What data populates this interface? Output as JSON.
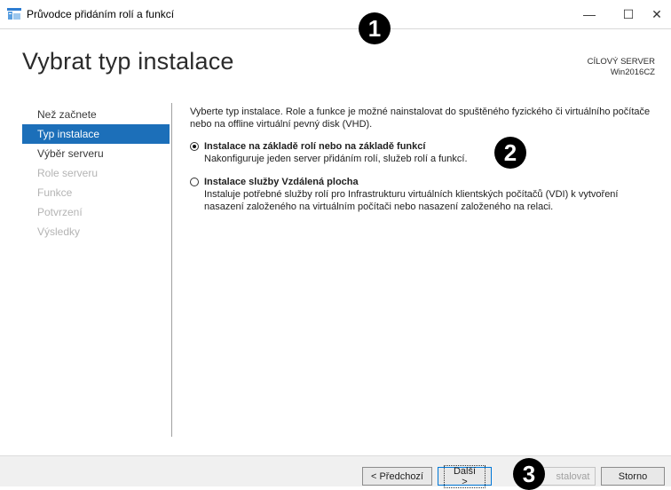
{
  "window": {
    "title": "Průvodce přidáním rolí a funkcí",
    "minimize_glyph": "—",
    "maximize_glyph": "☐",
    "close_glyph": "✕"
  },
  "page": {
    "title": "Vybrat typ instalace",
    "target_server_label": "CÍLOVÝ SERVER",
    "target_server_name": "Win2016CZ"
  },
  "nav": {
    "items": [
      {
        "label": "Než začnete",
        "state": "normal"
      },
      {
        "label": "Typ instalace",
        "state": "active"
      },
      {
        "label": "Výběr serveru",
        "state": "normal"
      },
      {
        "label": "Role serveru",
        "state": "disabled"
      },
      {
        "label": "Funkce",
        "state": "disabled"
      },
      {
        "label": "Potvrzení",
        "state": "disabled"
      },
      {
        "label": "Výsledky",
        "state": "disabled"
      }
    ]
  },
  "content": {
    "intro": "Vyberte typ instalace. Role a funkce je možné nainstalovat do spuštěného fyzického či virtuálního počítače nebo na offline virtuální pevný disk (VHD).",
    "options": [
      {
        "title": "Instalace na základě rolí nebo na základě funkcí",
        "description": "Nakonfiguruje jeden server přidáním rolí, služeb rolí a funkcí.",
        "selected": true
      },
      {
        "title": "Instalace služby Vzdálená plocha",
        "description": "Instaluje potřebné služby rolí pro Infrastrukturu virtuálních klientských počítačů (VDI) k vytvoření nasazení založeného na virtuálním počítači nebo nasazení založeného na relaci.",
        "selected": false
      }
    ]
  },
  "buttons": {
    "previous": "< Předchozí",
    "next": "Další >",
    "install": "stalovat",
    "cancel": "Storno"
  },
  "badges": {
    "one": "1",
    "two": "2",
    "three": "3"
  },
  "colors": {
    "accent": "#1c6fb9",
    "disabled_text": "#b4b4b4"
  }
}
